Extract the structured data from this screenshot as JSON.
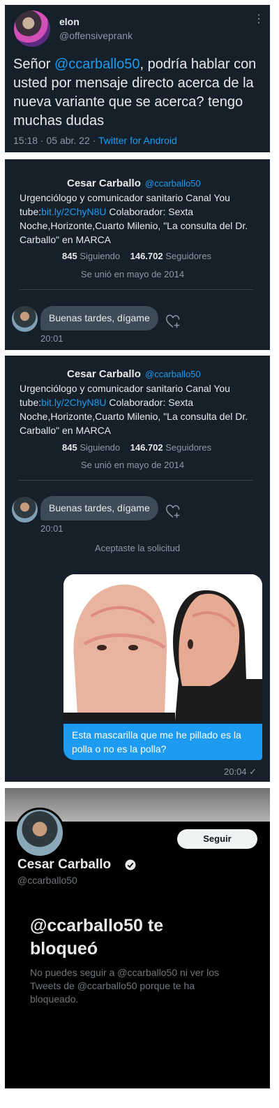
{
  "tweet": {
    "name": "elon",
    "handle": "@offensiveprank",
    "text_pre": "Señor ",
    "mention": "@ccarballo50",
    "text_post": ", podría hablar con usted por mensaje directo acerca de la nueva variante que se acerca? tengo muchas dudas",
    "date": "15:18 · 05 abr. 22 · ",
    "source": "Twitter for Android"
  },
  "dm_profile": {
    "name": "Cesar Carballo",
    "handle": "@ccarballo50",
    "bio_1": "Urgenciólogo y comunicador sanitario Canal You tube:",
    "bio_link": "bit.ly/2ChyN8U",
    "bio_2": " Colaborador: Sexta Noche,Horizonte,Cuarto Milenio, \"La consulta del Dr. Carballo\" en MARCA",
    "following_count": "845",
    "following_label": " Siguiendo",
    "followers_count": "146.702",
    "followers_label": " Seguidores",
    "joined": "Se unió en mayo de 2014"
  },
  "messages": {
    "incoming_text": "Buenas tardes, dígame",
    "incoming_time": "20:01",
    "system": "Aceptaste la solicitud",
    "outgoing_text": "Esta mascarilla que me he pillado es la polla o no es la polla?",
    "outgoing_time": "20:04 ✓"
  },
  "blocked_profile": {
    "follow_label": "Seguir",
    "name": "Cesar Carballo",
    "handle": "@ccarballo50",
    "title": "@ccarballo50 te bloqueó",
    "body": "No puedes seguir a @ccarballo50 ni ver los Tweets de @ccarballo50 porque te ha bloqueado."
  },
  "colors": {
    "accent": "#1d9bf0",
    "bg_dim": "#15202b",
    "bg_black": "#000000"
  }
}
